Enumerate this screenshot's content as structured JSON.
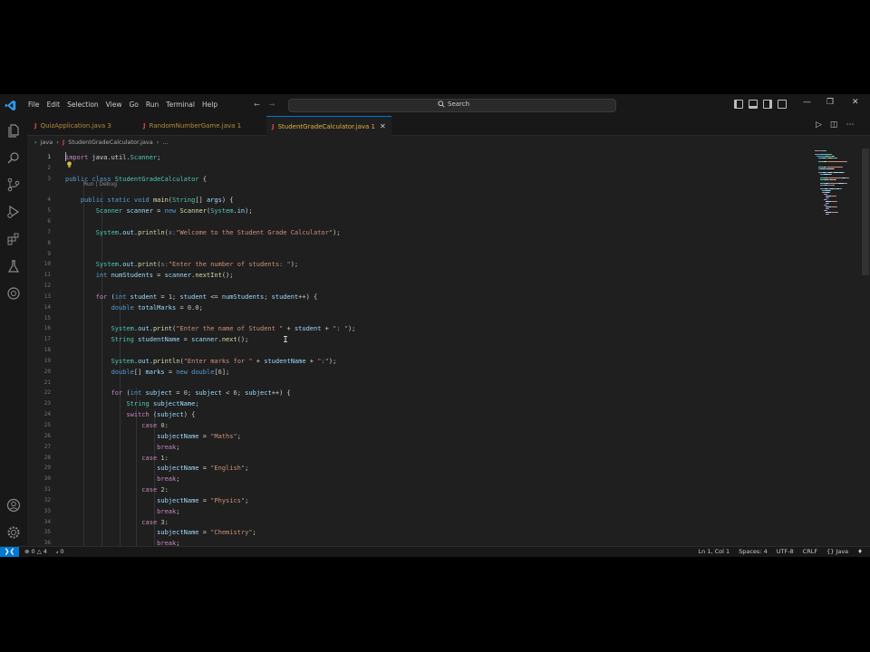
{
  "menu": [
    "File",
    "Edit",
    "Selection",
    "View",
    "Go",
    "Run",
    "Terminal",
    "Help"
  ],
  "search": {
    "label": "Search"
  },
  "tabs": [
    {
      "label": "QuizApplication.java",
      "badge": "3"
    },
    {
      "label": "RandomNumberGame.java",
      "badge": "1"
    },
    {
      "label": "StudentGradeCalculator.java",
      "badge": "1"
    }
  ],
  "breadcrumb": {
    "folder": "java",
    "file": "StudentGradeCalculator.java",
    "more": "..."
  },
  "codelens": "Run | Debug",
  "status": {
    "errors": "0",
    "warnings": "4",
    "ports": "0",
    "position": "Ln 1, Col 1",
    "spaces": "Spaces: 4",
    "encoding": "UTF-8",
    "eol": "CRLF",
    "language": "Java"
  },
  "colors": {
    "accent": "#0078d4",
    "editor_bg": "#1f1f1f",
    "chrome_bg": "#181818"
  },
  "code_lines": [
    {
      "n": "1",
      "segs": [
        [
          "kw2",
          "import"
        ],
        [
          "pl",
          " java.util."
        ],
        [
          "ty",
          "Scanner"
        ],
        [
          "pl",
          ";"
        ]
      ]
    },
    {
      "n": "2",
      "segs": []
    },
    {
      "n": "3",
      "segs": [
        [
          "kw",
          "public class "
        ],
        [
          "ty",
          "StudentGradeCalculator"
        ],
        [
          "pl",
          " {"
        ]
      ]
    },
    {
      "n": "4",
      "segs": [
        [
          "pl",
          "    "
        ],
        [
          "kw",
          "public static void "
        ],
        [
          "fn",
          "main"
        ],
        [
          "pl",
          "("
        ],
        [
          "ty",
          "String"
        ],
        [
          "pl",
          "[] "
        ],
        [
          "var",
          "args"
        ],
        [
          "pl",
          ") {"
        ]
      ]
    },
    {
      "n": "5",
      "segs": [
        [
          "pl",
          "        "
        ],
        [
          "ty",
          "Scanner"
        ],
        [
          "var",
          " scanner"
        ],
        [
          "pl",
          " = "
        ],
        [
          "kw",
          "new "
        ],
        [
          "fn",
          "Scanner"
        ],
        [
          "pl",
          "("
        ],
        [
          "ty",
          "System"
        ],
        [
          "pl",
          "."
        ],
        [
          "var",
          "in"
        ],
        [
          "pl",
          ");"
        ]
      ]
    },
    {
      "n": "6",
      "segs": []
    },
    {
      "n": "7",
      "segs": [
        [
          "pl",
          "        "
        ],
        [
          "ty",
          "System"
        ],
        [
          "pl",
          "."
        ],
        [
          "var",
          "out"
        ],
        [
          "pl",
          "."
        ],
        [
          "fn",
          "println"
        ],
        [
          "pl",
          "("
        ],
        [
          "hint",
          "x:"
        ],
        [
          "str",
          "\"Welcome to the Student Grade Calculator\""
        ],
        [
          "pl",
          ");"
        ]
      ]
    },
    {
      "n": "8",
      "segs": []
    },
    {
      "n": "9",
      "segs": []
    },
    {
      "n": "10",
      "segs": [
        [
          "pl",
          "        "
        ],
        [
          "ty",
          "System"
        ],
        [
          "pl",
          "."
        ],
        [
          "var",
          "out"
        ],
        [
          "pl",
          "."
        ],
        [
          "fn",
          "print"
        ],
        [
          "pl",
          "("
        ],
        [
          "hint",
          "s:"
        ],
        [
          "str",
          "\"Enter the number of students: \""
        ],
        [
          "pl",
          ");"
        ]
      ]
    },
    {
      "n": "11",
      "segs": [
        [
          "pl",
          "        "
        ],
        [
          "kw",
          "int "
        ],
        [
          "var",
          "numStudents"
        ],
        [
          "pl",
          " = "
        ],
        [
          "var",
          "scanner"
        ],
        [
          "pl",
          "."
        ],
        [
          "fn",
          "nextInt"
        ],
        [
          "pl",
          "();"
        ]
      ]
    },
    {
      "n": "12",
      "segs": []
    },
    {
      "n": "13",
      "segs": [
        [
          "pl",
          "        "
        ],
        [
          "kw2",
          "for "
        ],
        [
          "pl",
          "("
        ],
        [
          "kw",
          "int "
        ],
        [
          "var",
          "student"
        ],
        [
          "pl",
          " = "
        ],
        [
          "num",
          "1"
        ],
        [
          "pl",
          "; "
        ],
        [
          "var",
          "student"
        ],
        [
          "pl",
          " <= "
        ],
        [
          "var",
          "numStudents"
        ],
        [
          "pl",
          "; "
        ],
        [
          "var",
          "student"
        ],
        [
          "pl",
          "++) {"
        ]
      ]
    },
    {
      "n": "14",
      "segs": [
        [
          "pl",
          "            "
        ],
        [
          "kw",
          "double "
        ],
        [
          "var",
          "totalMarks"
        ],
        [
          "pl",
          " = "
        ],
        [
          "num",
          "0.0"
        ],
        [
          "pl",
          ";"
        ]
      ]
    },
    {
      "n": "15",
      "segs": []
    },
    {
      "n": "16",
      "segs": [
        [
          "pl",
          "            "
        ],
        [
          "ty",
          "System"
        ],
        [
          "pl",
          "."
        ],
        [
          "var",
          "out"
        ],
        [
          "pl",
          "."
        ],
        [
          "fn",
          "print"
        ],
        [
          "pl",
          "("
        ],
        [
          "str",
          "\"Enter the name of Student \""
        ],
        [
          "pl",
          " + "
        ],
        [
          "var",
          "student"
        ],
        [
          "pl",
          " + "
        ],
        [
          "str",
          "\": \""
        ],
        [
          "pl",
          ");"
        ]
      ]
    },
    {
      "n": "17",
      "segs": [
        [
          "pl",
          "            "
        ],
        [
          "ty",
          "String "
        ],
        [
          "var",
          "studentName"
        ],
        [
          "pl",
          " = "
        ],
        [
          "var",
          "scanner"
        ],
        [
          "pl",
          "."
        ],
        [
          "fn",
          "next"
        ],
        [
          "pl",
          "();"
        ]
      ]
    },
    {
      "n": "18",
      "segs": []
    },
    {
      "n": "19",
      "segs": [
        [
          "pl",
          "            "
        ],
        [
          "ty",
          "System"
        ],
        [
          "pl",
          "."
        ],
        [
          "var",
          "out"
        ],
        [
          "pl",
          "."
        ],
        [
          "fn",
          "println"
        ],
        [
          "pl",
          "("
        ],
        [
          "str",
          "\"Enter marks for \""
        ],
        [
          "pl",
          " + "
        ],
        [
          "var",
          "studentName"
        ],
        [
          "pl",
          " + "
        ],
        [
          "str",
          "\":\""
        ],
        [
          "pl",
          ");"
        ]
      ]
    },
    {
      "n": "20",
      "segs": [
        [
          "pl",
          "            "
        ],
        [
          "kw",
          "double"
        ],
        [
          "pl",
          "[] "
        ],
        [
          "var",
          "marks"
        ],
        [
          "pl",
          " = "
        ],
        [
          "kw",
          "new double"
        ],
        [
          "pl",
          "["
        ],
        [
          "num",
          "6"
        ],
        [
          "pl",
          "];"
        ]
      ]
    },
    {
      "n": "21",
      "segs": []
    },
    {
      "n": "22",
      "segs": [
        [
          "pl",
          "            "
        ],
        [
          "kw2",
          "for "
        ],
        [
          "pl",
          "("
        ],
        [
          "kw",
          "int "
        ],
        [
          "var",
          "subject"
        ],
        [
          "pl",
          " = "
        ],
        [
          "num",
          "0"
        ],
        [
          "pl",
          "; "
        ],
        [
          "var",
          "subject"
        ],
        [
          "pl",
          " < "
        ],
        [
          "num",
          "6"
        ],
        [
          "pl",
          "; "
        ],
        [
          "var",
          "subject"
        ],
        [
          "pl",
          "++) {"
        ]
      ]
    },
    {
      "n": "23",
      "segs": [
        [
          "pl",
          "                "
        ],
        [
          "ty",
          "String "
        ],
        [
          "var",
          "subjectName"
        ],
        [
          "pl",
          ";"
        ]
      ]
    },
    {
      "n": "24",
      "segs": [
        [
          "pl",
          "                "
        ],
        [
          "kw2",
          "switch "
        ],
        [
          "pl",
          "("
        ],
        [
          "var",
          "subject"
        ],
        [
          "pl",
          ") {"
        ]
      ]
    },
    {
      "n": "25",
      "segs": [
        [
          "pl",
          "                    "
        ],
        [
          "kw2",
          "case "
        ],
        [
          "num",
          "0"
        ],
        [
          "pl",
          ":"
        ]
      ]
    },
    {
      "n": "26",
      "segs": [
        [
          "pl",
          "                        "
        ],
        [
          "var",
          "subjectName"
        ],
        [
          "pl",
          " = "
        ],
        [
          "str",
          "\"Maths\""
        ],
        [
          "pl",
          ";"
        ]
      ]
    },
    {
      "n": "27",
      "segs": [
        [
          "pl",
          "                        "
        ],
        [
          "kw2",
          "break"
        ],
        [
          "pl",
          ";"
        ]
      ]
    },
    {
      "n": "28",
      "segs": [
        [
          "pl",
          "                    "
        ],
        [
          "kw2",
          "case "
        ],
        [
          "num",
          "1"
        ],
        [
          "pl",
          ":"
        ]
      ]
    },
    {
      "n": "29",
      "segs": [
        [
          "pl",
          "                        "
        ],
        [
          "var",
          "subjectName"
        ],
        [
          "pl",
          " = "
        ],
        [
          "str",
          "\"English\""
        ],
        [
          "pl",
          ";"
        ]
      ]
    },
    {
      "n": "30",
      "segs": [
        [
          "pl",
          "                        "
        ],
        [
          "kw2",
          "break"
        ],
        [
          "pl",
          ";"
        ]
      ]
    },
    {
      "n": "31",
      "segs": [
        [
          "pl",
          "                    "
        ],
        [
          "kw2",
          "case "
        ],
        [
          "num",
          "2"
        ],
        [
          "pl",
          ":"
        ]
      ]
    },
    {
      "n": "32",
      "segs": [
        [
          "pl",
          "                        "
        ],
        [
          "var",
          "subjectName"
        ],
        [
          "pl",
          " = "
        ],
        [
          "str",
          "\"Physics\""
        ],
        [
          "pl",
          ";"
        ]
      ]
    },
    {
      "n": "33",
      "segs": [
        [
          "pl",
          "                        "
        ],
        [
          "kw2",
          "break"
        ],
        [
          "pl",
          ";"
        ]
      ]
    },
    {
      "n": "34",
      "segs": [
        [
          "pl",
          "                    "
        ],
        [
          "kw2",
          "case "
        ],
        [
          "num",
          "3"
        ],
        [
          "pl",
          ":"
        ]
      ]
    },
    {
      "n": "35",
      "segs": [
        [
          "pl",
          "                        "
        ],
        [
          "var",
          "subjectName"
        ],
        [
          "pl",
          " = "
        ],
        [
          "str",
          "\"Chemistry\""
        ],
        [
          "pl",
          ";"
        ]
      ]
    },
    {
      "n": "36",
      "segs": [
        [
          "pl",
          "                        "
        ],
        [
          "kw2",
          "break"
        ],
        [
          "pl",
          ";"
        ]
      ]
    }
  ]
}
